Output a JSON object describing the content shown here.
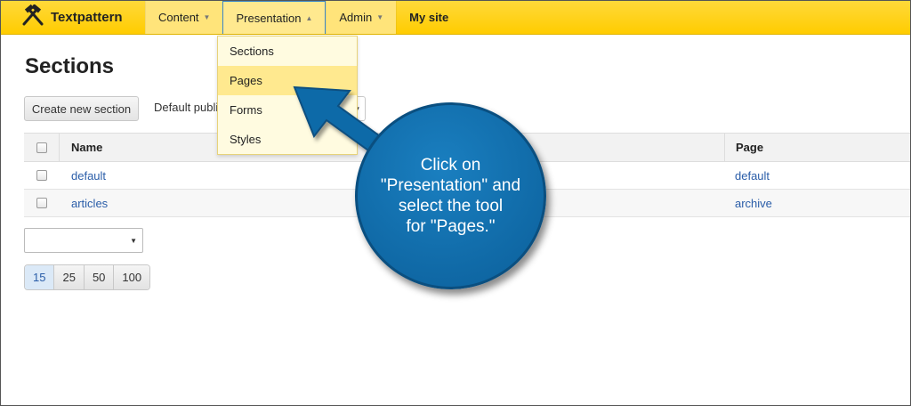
{
  "nav": {
    "brand": "Textpattern",
    "items": [
      {
        "label": "Content"
      },
      {
        "label": "Presentation"
      },
      {
        "label": "Admin"
      },
      {
        "label": "My site"
      }
    ]
  },
  "dropdown": {
    "items": [
      {
        "label": "Sections"
      },
      {
        "label": "Pages"
      },
      {
        "label": "Forms"
      },
      {
        "label": "Styles"
      }
    ]
  },
  "page": {
    "title": "Sections",
    "create_button": "Create new section",
    "default_label": "Default publi"
  },
  "table": {
    "headers": {
      "name": "Name",
      "page": "Page"
    },
    "rows": [
      {
        "name": "default",
        "page": "default"
      },
      {
        "name": "articles",
        "page": "archive"
      }
    ]
  },
  "pager": {
    "options": [
      "15",
      "25",
      "50",
      "100"
    ],
    "selected": "15"
  },
  "callout": {
    "line1": "Click on",
    "line2": "\"Presentation\" and",
    "line3": "select the tool",
    "line4": "for \"Pages.\""
  },
  "colors": {
    "topbar": "#ffcc00",
    "callout": "#0b6aa8",
    "link": "#2a5da8"
  }
}
